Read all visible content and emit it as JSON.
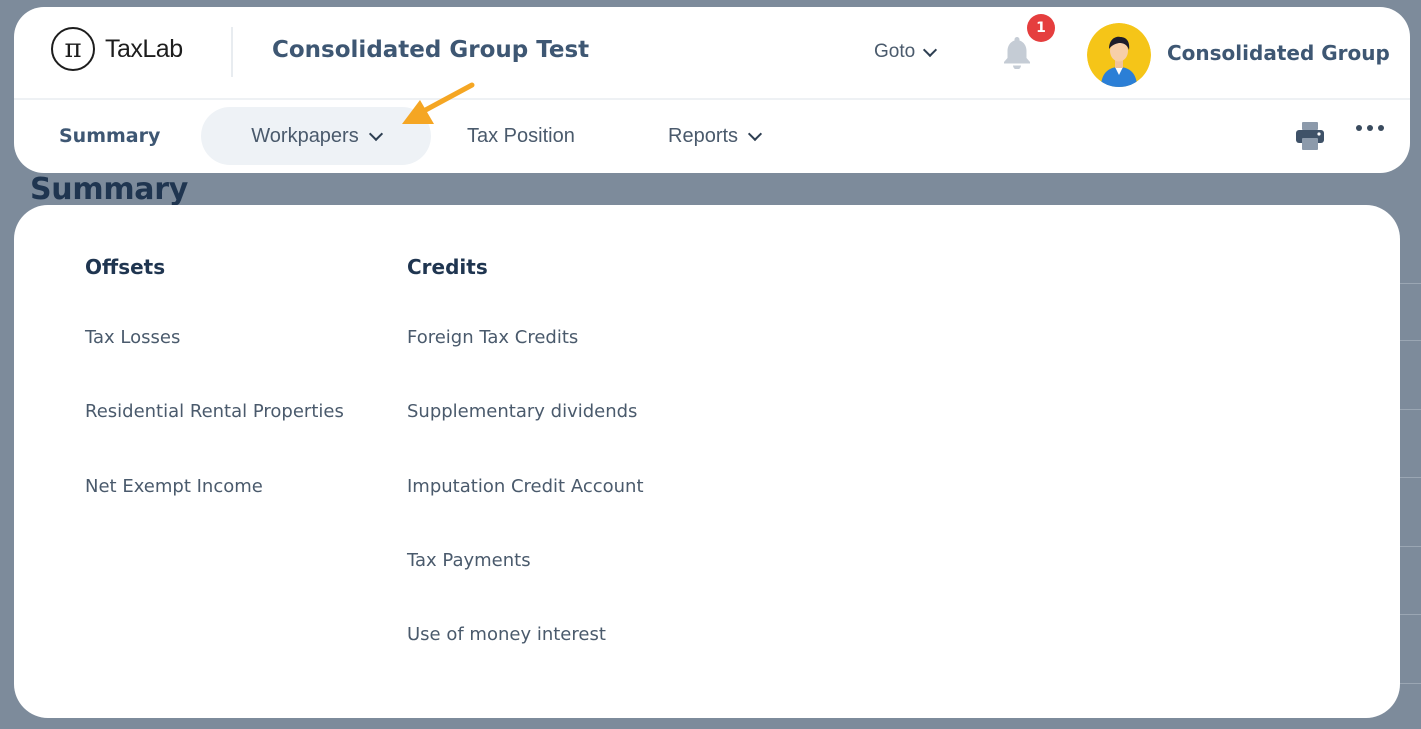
{
  "app": {
    "logo_symbol": "π",
    "logo_text": "TaxLab",
    "title": "Consolidated Group Test"
  },
  "header": {
    "goto_label": "Goto",
    "notification_count": "1",
    "user_name": "Consolidated Group"
  },
  "nav": {
    "tabs": [
      {
        "label": "Summary"
      },
      {
        "label": "Workpapers"
      },
      {
        "label": "Tax Position"
      },
      {
        "label": "Reports"
      }
    ]
  },
  "page": {
    "heading": "Summary"
  },
  "dropdown": {
    "columns": [
      {
        "heading": "Offsets",
        "items": [
          "Tax Losses",
          "Residential Rental Properties",
          "Net Exempt Income"
        ]
      },
      {
        "heading": "Credits",
        "items": [
          "Foreign Tax Credits",
          "Supplementary dividends",
          "Imputation Credit Account",
          "Tax Payments",
          "Use of money interest"
        ]
      }
    ]
  },
  "colors": {
    "accent_arrow": "#f5a623",
    "badge": "#e53e3e",
    "heading": "#1f3550"
  }
}
